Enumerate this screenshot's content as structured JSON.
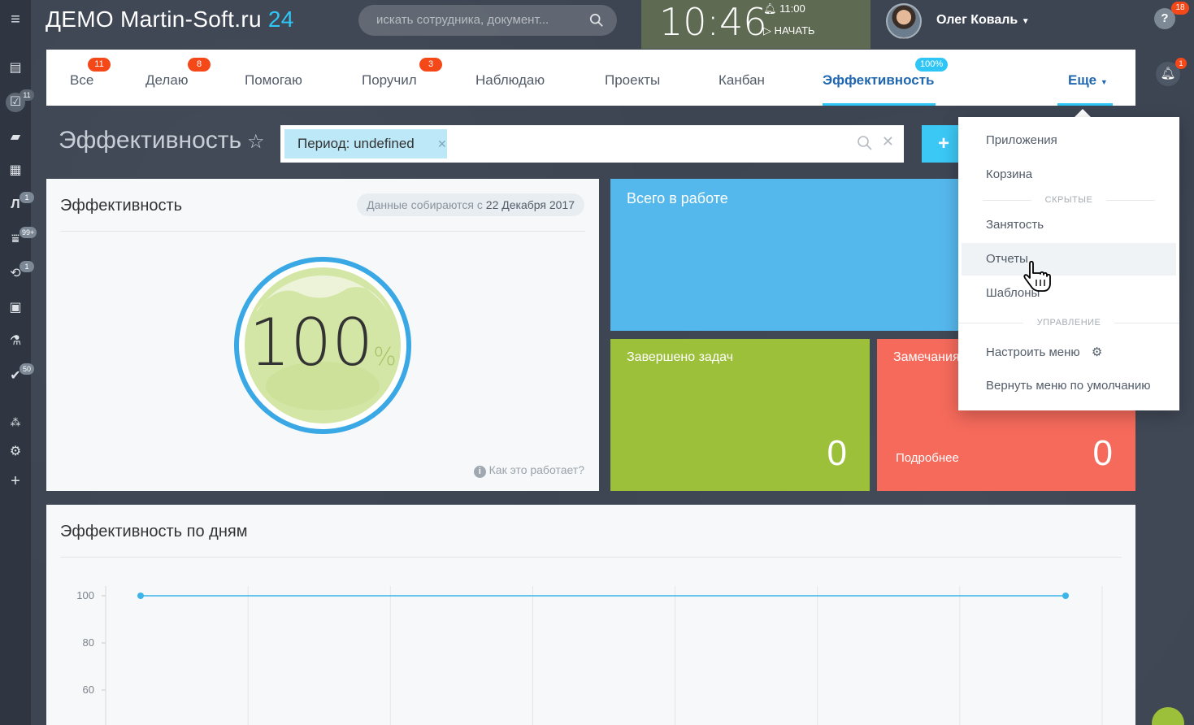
{
  "header": {
    "logo_text": "ДЕМО Martin-Soft.ru",
    "logo_number": "24",
    "search_placeholder": "искать сотрудника, документ...",
    "clock_time": "10:46",
    "alarm_time": "11:00",
    "start_label": "НАЧАТЬ",
    "user_name": "Олег Коваль",
    "help_badge": "18",
    "bell_badge": "1"
  },
  "sidebar": {
    "badges": [
      "11",
      "1",
      "99+",
      "1",
      "50"
    ]
  },
  "tabs": [
    {
      "label": "Все",
      "badge": "11"
    },
    {
      "label": "Делаю",
      "badge": "8"
    },
    {
      "label": "Помогаю",
      "badge": ""
    },
    {
      "label": "Поручил",
      "badge": "3"
    },
    {
      "label": "Наблюдаю",
      "badge": ""
    },
    {
      "label": "Проекты",
      "badge": ""
    },
    {
      "label": "Канбан",
      "badge": ""
    },
    {
      "label": "Эффективность",
      "badge": "100%"
    },
    {
      "label": "Еще",
      "badge": ""
    }
  ],
  "page": {
    "title": "Эффективность",
    "filter_chip": "Период: undefined"
  },
  "efficiency_card": {
    "title": "Эффективность",
    "data_since_prefix": "Данные собираются с",
    "data_since_date": "22 Декабря 2017",
    "value": "100",
    "unit": "%",
    "how_it_works": "Как это работает?"
  },
  "tiles": {
    "total": {
      "title": "Всего в работе"
    },
    "done": {
      "title": "Завершено задач",
      "count": "0"
    },
    "remarks": {
      "title": "Замечания",
      "more": "Подробнее",
      "count": "0"
    }
  },
  "dropdown": {
    "items_top": [
      "Приложения",
      "Корзина"
    ],
    "section_hidden": "СКРЫТЫЕ",
    "items_hidden": [
      "Занятость",
      "Отчеты",
      "Шаблоны"
    ],
    "section_manage": "УПРАВЛЕНИЕ",
    "items_manage": [
      "Настроить меню",
      "Вернуть меню по умолчанию"
    ]
  },
  "chart_data": {
    "type": "line",
    "title": "Эффективность по дням",
    "xlabel": "",
    "ylabel": "",
    "ylim": [
      50,
      100
    ],
    "yticks": [
      100,
      80,
      60
    ],
    "series": [
      {
        "values": [
          100,
          100
        ]
      }
    ],
    "grid": true
  },
  "colors": {
    "accent": "#2fc6f6",
    "tile_total": "#55b8ed",
    "tile_done": "#9dc03a",
    "tile_remarks": "#f56a5b",
    "badge_red": "#f54819"
  }
}
